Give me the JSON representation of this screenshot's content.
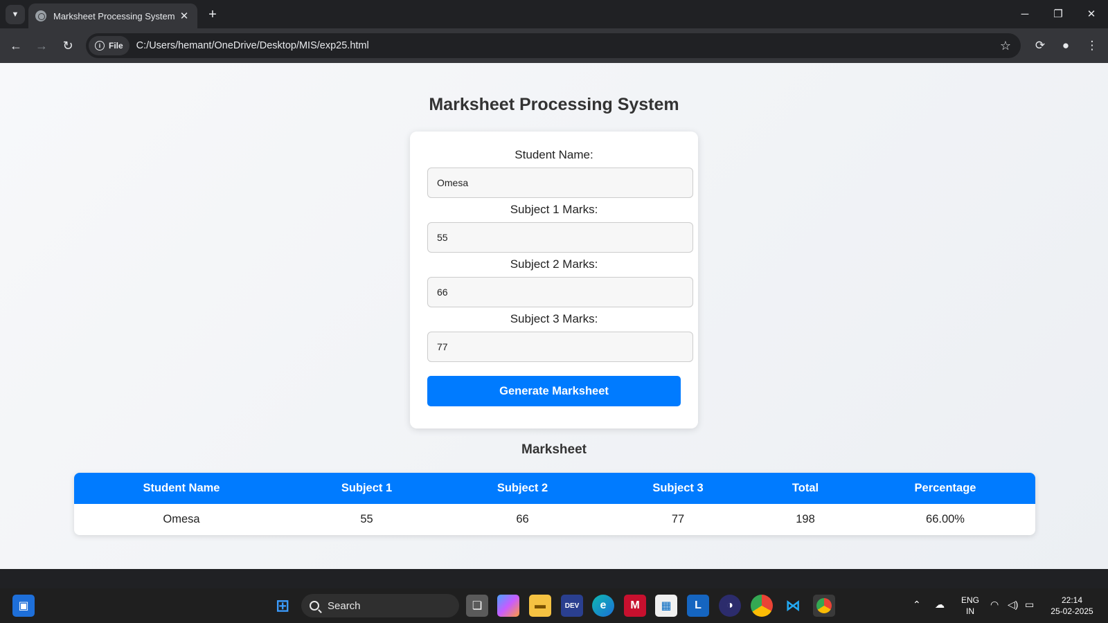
{
  "browser": {
    "tab_title": "Marksheet Processing System",
    "site_chip": "File",
    "url": "C:/Users/hemant/OneDrive/Desktop/MIS/exp25.html"
  },
  "page": {
    "title": "Marksheet Processing System",
    "form": {
      "name_label": "Student Name:",
      "name_value": "Omesa",
      "s1_label": "Subject 1 Marks:",
      "s1_value": "55",
      "s2_label": "Subject 2 Marks:",
      "s2_value": "66",
      "s3_label": "Subject 3 Marks:",
      "s3_value": "77",
      "button_label": "Generate Marksheet"
    },
    "marksheet": {
      "title": "Marksheet",
      "headers": [
        "Student Name",
        "Subject 1",
        "Subject 2",
        "Subject 3",
        "Total",
        "Percentage"
      ],
      "rows": [
        [
          "Omesa",
          "55",
          "66",
          "77",
          "198",
          "66.00%"
        ]
      ]
    }
  },
  "taskbar": {
    "search_label": "Search",
    "lang_top": "ENG",
    "lang_bottom": "IN",
    "time": "22:14",
    "date": "25-02-2025"
  },
  "colors": {
    "accent": "#007bff",
    "chrome_dark": "#202124",
    "chrome_toolbar": "#35363a"
  }
}
